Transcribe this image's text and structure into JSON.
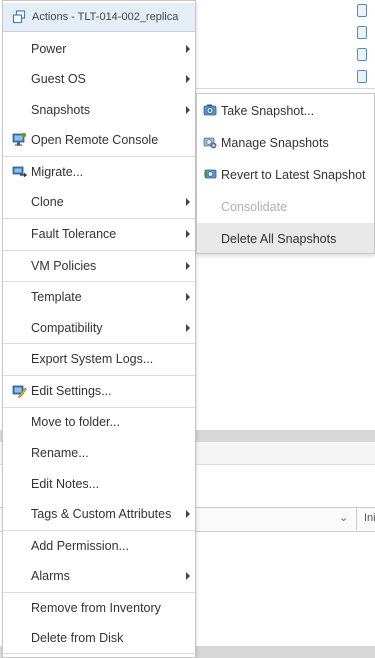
{
  "menu": {
    "title": "Actions - TLT-014-002_replica",
    "items": [
      {
        "label": "Power",
        "has_submenu": true
      },
      {
        "label": "Guest OS",
        "has_submenu": true
      },
      {
        "label": "Snapshots",
        "has_submenu": true
      },
      {
        "label": "Open Remote Console",
        "has_submenu": false
      },
      {
        "label": "Migrate...",
        "has_submenu": false
      },
      {
        "label": "Clone",
        "has_submenu": true
      },
      {
        "label": "Fault Tolerance",
        "has_submenu": true
      },
      {
        "label": "VM Policies",
        "has_submenu": true
      },
      {
        "label": "Template",
        "has_submenu": true
      },
      {
        "label": "Compatibility",
        "has_submenu": true
      },
      {
        "label": "Export System Logs...",
        "has_submenu": false
      },
      {
        "label": "Edit Settings...",
        "has_submenu": false
      },
      {
        "label": "Move to folder...",
        "has_submenu": false
      },
      {
        "label": "Rename...",
        "has_submenu": false
      },
      {
        "label": "Edit Notes...",
        "has_submenu": false
      },
      {
        "label": "Tags & Custom Attributes",
        "has_submenu": true
      },
      {
        "label": "Add Permission...",
        "has_submenu": false
      },
      {
        "label": "Alarms",
        "has_submenu": true
      },
      {
        "label": "Remove from Inventory",
        "has_submenu": false
      },
      {
        "label": "Delete from Disk",
        "has_submenu": false
      }
    ]
  },
  "submenu": {
    "items": [
      {
        "label": "Take Snapshot...",
        "icon": "take-snapshot-icon",
        "enabled": true
      },
      {
        "label": "Manage Snapshots",
        "icon": "manage-snapshots-icon",
        "enabled": true
      },
      {
        "label": "Revert to Latest Snapshot",
        "icon": "revert-snapshot-icon",
        "enabled": true
      },
      {
        "label": "Consolidate",
        "icon": "",
        "enabled": false
      },
      {
        "label": "Delete All Snapshots",
        "icon": "",
        "enabled": true,
        "hovered": true
      }
    ]
  },
  "background": {
    "column_label": "Ini"
  },
  "colors": {
    "header_bg": "#e5eef6",
    "hover_bg": "#e8e8e8",
    "disabled_text": "#b0b0b0",
    "accent_blue": "#3a79b8"
  }
}
